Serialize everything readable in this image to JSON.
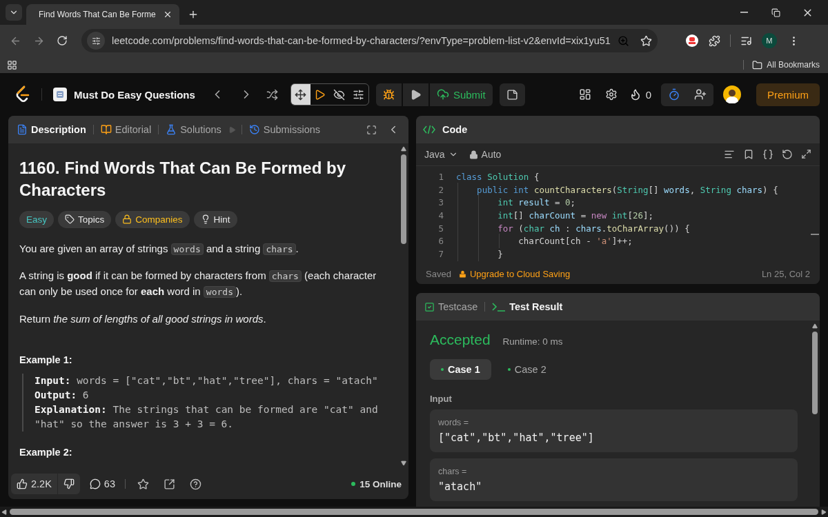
{
  "browser": {
    "tab": {
      "title": "Find Words That Can Be Forme"
    },
    "url": "leetcode.com/problems/find-words-that-can-be-formed-by-characters/?envType=problem-list-v2&envId=xix1yu51",
    "profile_initial": "M",
    "bookmarks_label": "All Bookmarks"
  },
  "nav": {
    "list_title": "Must Do Easy Questions",
    "submit_label": "Submit",
    "streak": "0",
    "premium_label": "Premium"
  },
  "description_panel": {
    "tabs": [
      {
        "label": "Description",
        "selected": true
      },
      {
        "label": "Editorial",
        "selected": false
      },
      {
        "label": "Solutions",
        "selected": false
      },
      {
        "label": "Submissions",
        "selected": false
      }
    ],
    "title": "1160. Find Words That Can Be Formed by Characters",
    "tags": [
      {
        "label": "Easy",
        "kind": "difficulty"
      },
      {
        "label": "Topics",
        "kind": "topics"
      },
      {
        "label": "Companies",
        "kind": "companies"
      },
      {
        "label": "Hint",
        "kind": "hint"
      }
    ],
    "paragraphs": [
      [
        {
          "kind": "text",
          "text": "You are given an array of strings "
        },
        {
          "kind": "code",
          "text": "words"
        },
        {
          "kind": "text",
          "text": " and a string "
        },
        {
          "kind": "code",
          "text": "chars"
        },
        {
          "kind": "text",
          "text": "."
        }
      ],
      [
        {
          "kind": "text",
          "text": "A string is **good** if it can be formed by characters from "
        },
        {
          "kind": "code",
          "text": "chars"
        },
        {
          "kind": "text",
          "text": " (each character can only be used once for **each** word in "
        },
        {
          "kind": "code",
          "text": "words"
        },
        {
          "kind": "text",
          "text": ")."
        }
      ],
      [
        {
          "kind": "text",
          "text": "Return *the sum of lengths of all good strings in words*."
        }
      ]
    ],
    "examples": [
      {
        "heading": "Example 1:",
        "lines": [
          {
            "label": "Input:",
            "text": "words = [\"cat\",\"bt\",\"hat\",\"tree\"], chars = \"atach\""
          },
          {
            "label": "Output:",
            "text": "6"
          },
          {
            "label": "Explanation:",
            "text": "The strings that can be formed are \"cat\" and \"hat\" so the answer is 3 + 3 = 6."
          }
        ]
      },
      {
        "heading": "Example 2:"
      }
    ],
    "likes": "2.2K",
    "comments": "63",
    "online": "15 Online"
  },
  "code_panel": {
    "title": "Code",
    "language": "Java",
    "mode": "Auto",
    "lines": [
      {
        "number": "1",
        "tokens": [
          {
            "kind": "kw",
            "text": "class "
          },
          {
            "kind": "type",
            "text": "Solution"
          },
          {
            "kind": "p",
            "text": " {"
          }
        ]
      },
      {
        "number": "2",
        "tokens": [
          {
            "kind": "kw",
            "text": "    public int "
          },
          {
            "kind": "fn",
            "text": "countCharacters"
          },
          {
            "kind": "p",
            "text": "("
          },
          {
            "kind": "type",
            "text": "String"
          },
          {
            "kind": "p",
            "text": "[] "
          },
          {
            "kind": "var",
            "text": "words"
          },
          {
            "kind": "p",
            "text": ", "
          },
          {
            "kind": "type",
            "text": "String "
          },
          {
            "kind": "var",
            "text": "chars"
          },
          {
            "kind": "p",
            "text": ") {"
          }
        ]
      },
      {
        "number": "3",
        "tokens": [
          {
            "kind": "type",
            "text": "        int "
          },
          {
            "kind": "var",
            "text": "result"
          },
          {
            "kind": "p",
            "text": " = "
          },
          {
            "kind": "num",
            "text": "0"
          },
          {
            "kind": "p",
            "text": ";"
          }
        ]
      },
      {
        "number": "4",
        "tokens": [
          {
            "kind": "type",
            "text": "        int"
          },
          {
            "kind": "p",
            "text": "[] "
          },
          {
            "kind": "var",
            "text": "charCount"
          },
          {
            "kind": "p",
            "text": " = "
          },
          {
            "kind": "ctrl",
            "text": "new "
          },
          {
            "kind": "type",
            "text": "int"
          },
          {
            "kind": "p",
            "text": "["
          },
          {
            "kind": "num",
            "text": "26"
          },
          {
            "kind": "p",
            "text": "];"
          }
        ]
      },
      {
        "number": "5",
        "tokens": [
          {
            "kind": "ctrl",
            "text": "        for"
          },
          {
            "kind": "p",
            "text": " ("
          },
          {
            "kind": "type",
            "text": "char "
          },
          {
            "kind": "var",
            "text": "ch"
          },
          {
            "kind": "p",
            "text": " : "
          },
          {
            "kind": "var",
            "text": "chars"
          },
          {
            "kind": "p",
            "text": "."
          },
          {
            "kind": "fn",
            "text": "toCharArray"
          },
          {
            "kind": "p",
            "text": "()) {"
          }
        ]
      },
      {
        "number": "6",
        "tokens": [
          {
            "kind": "p",
            "text": "            charCount[ch - "
          },
          {
            "kind": "str",
            "text": "'a'"
          },
          {
            "kind": "p",
            "text": "]++;"
          }
        ]
      },
      {
        "number": "7",
        "tokens": [
          {
            "kind": "p",
            "text": "        }"
          }
        ]
      }
    ],
    "saved": "Saved",
    "upgrade": "Upgrade to Cloud Saving",
    "cursor": "Ln 25, Col 2"
  },
  "result_panel": {
    "tabs": [
      {
        "label": "Testcase",
        "selected": false
      },
      {
        "label": "Test Result",
        "selected": true
      }
    ],
    "status": "Accepted",
    "runtime": "Runtime: 0 ms",
    "cases": [
      {
        "label": "Case 1",
        "selected": true
      },
      {
        "label": "Case 2",
        "selected": false
      }
    ],
    "input_label": "Input",
    "inputs": [
      {
        "name": "words =",
        "value": "[\"cat\",\"bt\",\"hat\",\"tree\"]"
      },
      {
        "name": "chars =",
        "value": "\"atach\""
      }
    ]
  }
}
